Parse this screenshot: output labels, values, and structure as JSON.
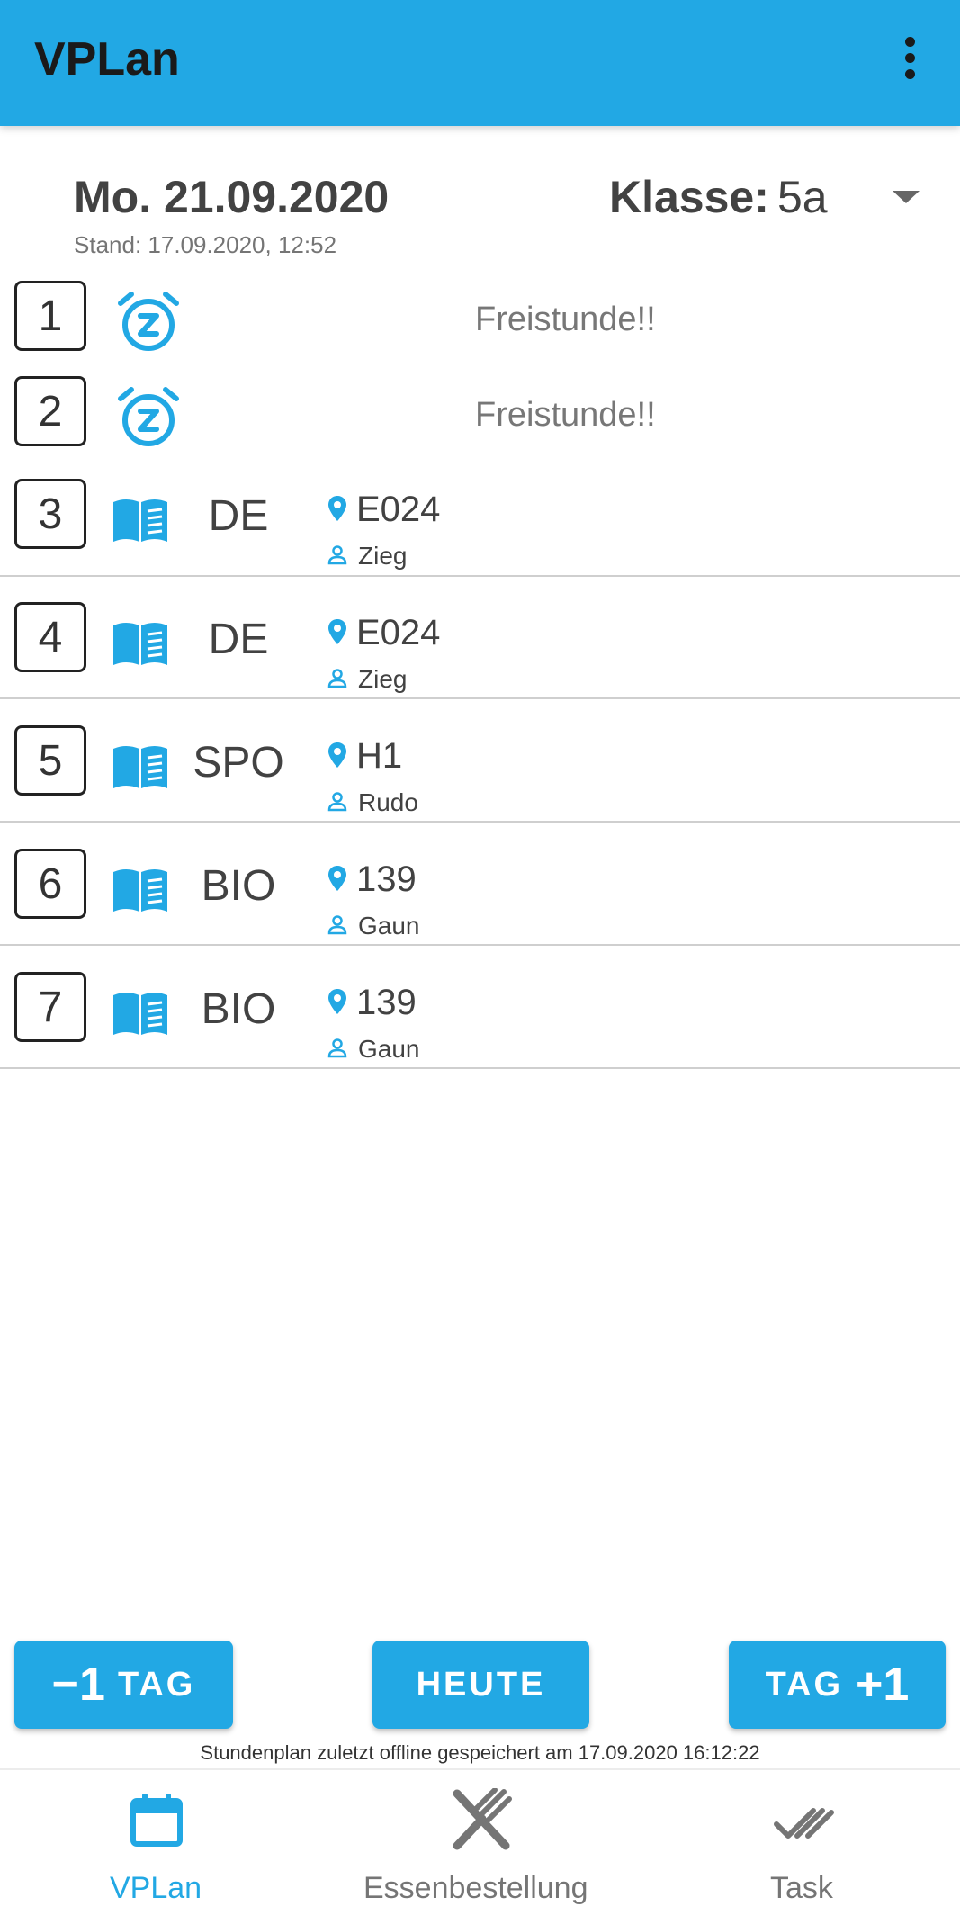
{
  "appbar": {
    "title": "VPLan",
    "menu_icon": "more-vert-icon"
  },
  "header": {
    "date": "Mo. 21.09.2020",
    "stand": "Stand: 17.09.2020, 12:52",
    "klasse_label": "Klasse:",
    "klasse_value": "5a"
  },
  "free_periods": [
    {
      "number": "1",
      "text": "Freistunde!!",
      "icon": "alarm-snooze-icon"
    },
    {
      "number": "2",
      "text": "Freistunde!!",
      "icon": "alarm-snooze-icon"
    }
  ],
  "lessons": [
    {
      "number": "3",
      "subject": "DE",
      "room": "E024",
      "teacher": "Zieg",
      "icon": "book-icon"
    },
    {
      "number": "4",
      "subject": "DE",
      "room": "E024",
      "teacher": "Zieg",
      "icon": "book-icon"
    },
    {
      "number": "5",
      "subject": "SPO",
      "room": "H1",
      "teacher": "Rudo",
      "icon": "book-icon"
    },
    {
      "number": "6",
      "subject": "BIO",
      "room": "139",
      "teacher": "Gaun",
      "icon": "book-icon"
    },
    {
      "number": "7",
      "subject": "BIO",
      "room": "139",
      "teacher": "Gaun",
      "icon": "book-icon"
    }
  ],
  "buttons": {
    "prev_big": "−1",
    "prev_small": "TAG",
    "today": "HEUTE",
    "next_small": "TAG",
    "next_big": "+1"
  },
  "offline_note": "Stundenplan zuletzt offline gespeichert am 17.09.2020 16:12:22",
  "bottom_nav": [
    {
      "label": "VPLan",
      "icon": "calendar-icon",
      "active": true
    },
    {
      "label": "Essenbestellung",
      "icon": "fork-knife-icon",
      "active": false
    },
    {
      "label": "Task",
      "icon": "double-check-icon",
      "active": false
    }
  ],
  "colors": {
    "accent": "#22a8e4",
    "text": "#424242",
    "inactive": "#757575"
  }
}
